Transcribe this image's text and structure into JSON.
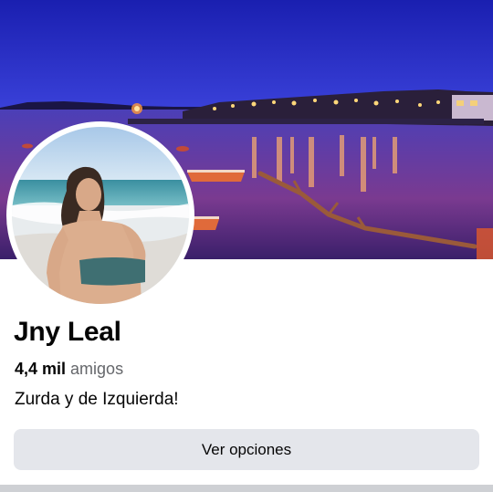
{
  "profile": {
    "name": "Jny Leal",
    "friends_count": "4,4 mil",
    "friends_label": "amigos",
    "bio": "Zurda y de Izquierda!"
  },
  "actions": {
    "options_label": "Ver opciones"
  },
  "colors": {
    "options_button_bg": "#e4e6eb",
    "secondary_text": "#65676b",
    "primary_text": "#050505"
  }
}
